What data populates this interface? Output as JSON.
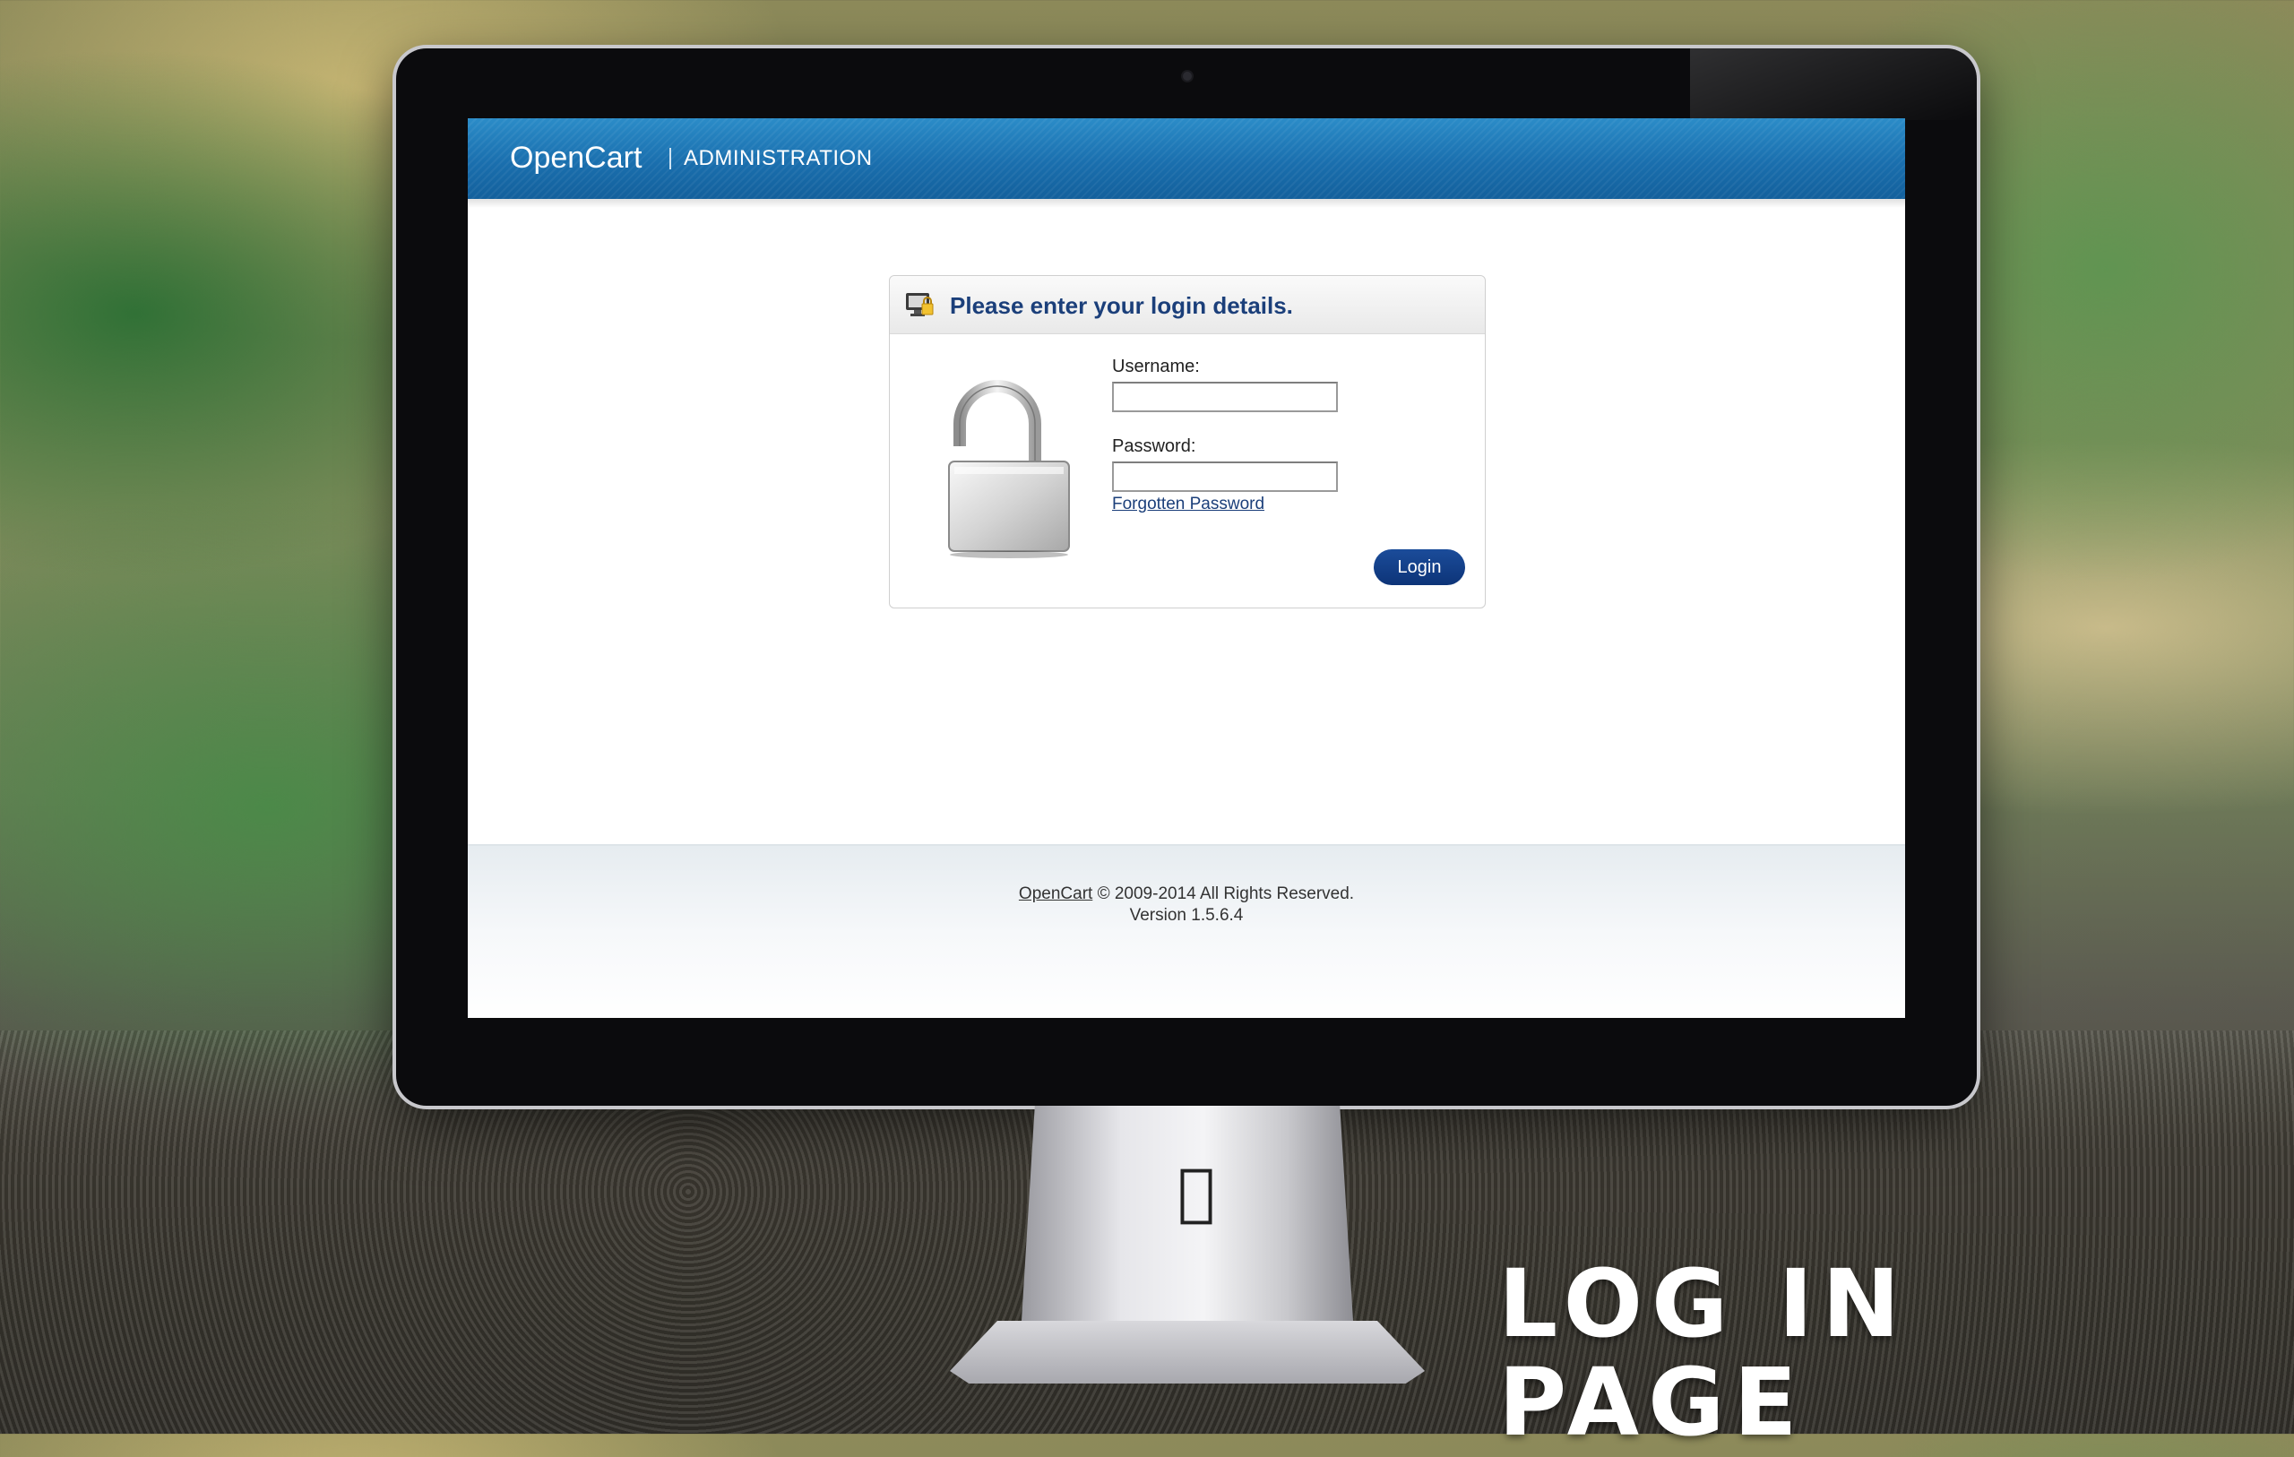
{
  "header": {
    "brand": "OpenCart",
    "subtitle": "ADMINISTRATION"
  },
  "login": {
    "title": "Please enter your login details.",
    "username_label": "Username:",
    "username_value": "",
    "password_label": "Password:",
    "password_value": "",
    "forgot_link": "Forgotten Password",
    "login_button": "Login"
  },
  "footer": {
    "brand_link": "OpenCart",
    "copyright": " © 2009-2014 All Rights Reserved.",
    "version": "Version 1.5.6.4"
  },
  "caption": "LOG IN PAGE",
  "colors": {
    "header_blue": "#1a6fae",
    "title_blue": "#1b3f7a",
    "button_blue": "#0d3478"
  }
}
